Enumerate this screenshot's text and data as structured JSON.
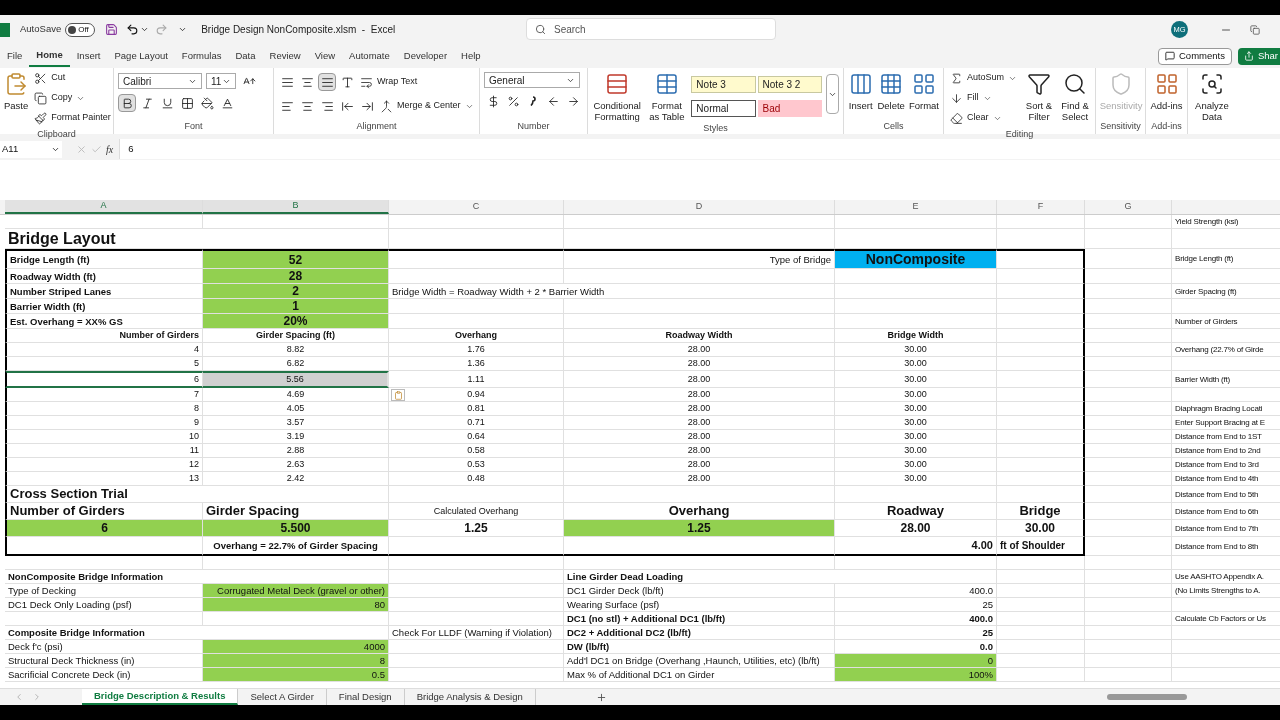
{
  "title_bar": {
    "autosave_label": "AutoSave",
    "autosave": {
      "on": false,
      "label": "Off"
    },
    "file_title": "Bridge Design NonComposite.xlsm  -  Excel",
    "search_placeholder": "Search",
    "user_initials": "MG"
  },
  "menu_tabs": [
    {
      "label": "File",
      "selected": false
    },
    {
      "label": "Home",
      "selected": true
    },
    {
      "label": "Insert",
      "selected": false
    },
    {
      "label": "Page Layout",
      "selected": false
    },
    {
      "label": "Formulas",
      "selected": false
    },
    {
      "label": "Data",
      "selected": false
    },
    {
      "label": "Review",
      "selected": false
    },
    {
      "label": "View",
      "selected": false
    },
    {
      "label": "Automate",
      "selected": false
    },
    {
      "label": "Developer",
      "selected": false
    },
    {
      "label": "Help",
      "selected": false
    }
  ],
  "comments_button": "Comments",
  "share_button": "Shar",
  "ribbon": {
    "clipboard": {
      "group": "Clipboard",
      "paste": "Paste",
      "cut": "Cut",
      "copy": "Copy",
      "format_painter": "Format Painter"
    },
    "font": {
      "group": "Font",
      "font_name": "Calibri",
      "font_size": "11",
      "bold": true
    },
    "alignment": {
      "group": "Alignment",
      "wrap_text": "Wrap Text",
      "merge_center": "Merge & Center",
      "bottom_align": true
    },
    "number": {
      "group": "Number",
      "format": "General"
    },
    "styles": {
      "group": "Styles",
      "conditional": "Conditional Formatting",
      "format_table": "Format as Table",
      "cell_styles": [
        {
          "label": "Note 3",
          "kind": "note"
        },
        {
          "label": "Note 3 2",
          "kind": "note"
        },
        {
          "label": "Normal",
          "kind": "normal"
        },
        {
          "label": "Bad",
          "kind": "bad"
        }
      ]
    },
    "cells": {
      "group": "Cells",
      "insert": "Insert",
      "delete": "Delete",
      "format": "Format"
    },
    "editing": {
      "group": "Editing",
      "autosum": "AutoSum",
      "fill": "Fill",
      "clear": "Clear",
      "sort": "Sort & Filter",
      "find": "Find & Select"
    },
    "sensitivity": {
      "group": "Sensitivity",
      "button": "Sensitivity",
      "disabled": true
    },
    "addins": {
      "group": "Add-ins",
      "button": "Add-ins"
    },
    "analyze": {
      "button": "Analyze Data"
    }
  },
  "formula_bar": {
    "name_box": "A11",
    "fx": "fx",
    "value": "6"
  },
  "sheet": {
    "column_headers": [
      {
        "label": "A",
        "selected": true
      },
      {
        "label": "B",
        "selected": true
      },
      {
        "label": "C",
        "selected": false
      },
      {
        "label": "D",
        "selected": false
      },
      {
        "label": "E",
        "selected": false
      },
      {
        "label": "F",
        "selected": false
      },
      {
        "label": "G",
        "selected": false
      }
    ],
    "rows": [
      {
        "boxed": false,
        "selected": false,
        "cells": {
          "h": {
            "text": "Yield Strength (ksi)",
            "kind": "text"
          }
        }
      },
      {
        "boxed": false,
        "selected": false,
        "cells": {
          "a": {
            "text": "Bridge Layout",
            "kind": "title"
          }
        }
      },
      {
        "boxed": true,
        "selected": false,
        "cells": {
          "a": {
            "text": "Bridge Length (ft)",
            "kind": "label"
          },
          "b": {
            "text": "52",
            "kind": "input-big"
          },
          "d": {
            "text": "Type of Bridge",
            "kind": "text-right"
          },
          "e": {
            "text": "NonComposite",
            "kind": "type-value"
          },
          "h": {
            "text": "Bridge Length (ft)",
            "kind": "text"
          }
        }
      },
      {
        "boxed": true,
        "selected": false,
        "cells": {
          "a": {
            "text": "Roadway Width (ft)",
            "kind": "label"
          },
          "b": {
            "text": "28",
            "kind": "input-big"
          }
        }
      },
      {
        "boxed": true,
        "selected": false,
        "cells": {
          "a": {
            "text": "Number Striped Lanes",
            "kind": "label"
          },
          "b": {
            "text": "2",
            "kind": "input-big"
          },
          "c": {
            "text": "Bridge Width = Roadway Width + 2 * Barrier Width",
            "kind": "text"
          },
          "h": {
            "text": "Girder Spacing (ft)",
            "kind": "text"
          }
        }
      },
      {
        "boxed": true,
        "selected": false,
        "cells": {
          "a": {
            "text": "Barrier Width (ft)",
            "kind": "label"
          },
          "b": {
            "text": "1",
            "kind": "input-big"
          }
        }
      },
      {
        "boxed": true,
        "selected": false,
        "cells": {
          "a": {
            "text": "Est. Overhang = XX% GS",
            "kind": "label"
          },
          "b": {
            "text": "20%",
            "kind": "input-big"
          },
          "h": {
            "text": "Number of Girders",
            "kind": "text"
          }
        }
      },
      {
        "boxed": true,
        "selected": false,
        "cells": {
          "a": {
            "text": "Number of Girders",
            "kind": "col-head-right"
          },
          "b": {
            "text": "Girder Spacing (ft)",
            "kind": "col-head"
          },
          "c": {
            "text": "Overhang",
            "kind": "col-head"
          },
          "d": {
            "text": "Roadway Width",
            "kind": "col-head"
          },
          "e": {
            "text": "Bridge Width",
            "kind": "col-head"
          }
        }
      },
      {
        "boxed": true,
        "selected": false,
        "cells": {
          "a": {
            "text": "4",
            "kind": "num-right"
          },
          "b": {
            "text": "8.82",
            "kind": "num"
          },
          "c": {
            "text": "1.76",
            "kind": "num"
          },
          "d": {
            "text": "28.00",
            "kind": "num"
          },
          "e": {
            "text": "30.00",
            "kind": "num"
          },
          "h": {
            "text": "Overhang (22.7% of Girde",
            "kind": "text"
          }
        }
      },
      {
        "boxed": true,
        "selected": false,
        "cells": {
          "a": {
            "text": "5",
            "kind": "num-right"
          },
          "b": {
            "text": "6.82",
            "kind": "num"
          },
          "c": {
            "text": "1.36",
            "kind": "num"
          },
          "d": {
            "text": "28.00",
            "kind": "num"
          },
          "e": {
            "text": "30.00",
            "kind": "num"
          }
        }
      },
      {
        "boxed": true,
        "selected": true,
        "cells": {
          "a": {
            "text": "6",
            "kind": "num-right"
          },
          "b": {
            "text": "5.56",
            "kind": "num"
          },
          "c": {
            "text": "1.11",
            "kind": "num"
          },
          "d": {
            "text": "28.00",
            "kind": "num"
          },
          "e": {
            "text": "30.00",
            "kind": "num"
          },
          "h": {
            "text": "Barrier Width (ft)",
            "kind": "text"
          }
        }
      },
      {
        "boxed": true,
        "selected": false,
        "paste_options": true,
        "cells": {
          "a": {
            "text": "7",
            "kind": "num-right"
          },
          "b": {
            "text": "4.69",
            "kind": "num"
          },
          "c": {
            "text": "0.94",
            "kind": "num"
          },
          "d": {
            "text": "28.00",
            "kind": "num"
          },
          "e": {
            "text": "30.00",
            "kind": "num"
          }
        }
      },
      {
        "boxed": true,
        "selected": false,
        "cells": {
          "a": {
            "text": "8",
            "kind": "num-right"
          },
          "b": {
            "text": "4.05",
            "kind": "num"
          },
          "c": {
            "text": "0.81",
            "kind": "num"
          },
          "d": {
            "text": "28.00",
            "kind": "num"
          },
          "e": {
            "text": "30.00",
            "kind": "num"
          },
          "h": {
            "text": "Diaphragm Bracing Locati",
            "kind": "text"
          }
        }
      },
      {
        "boxed": true,
        "selected": false,
        "cells": {
          "a": {
            "text": "9",
            "kind": "num-right"
          },
          "b": {
            "text": "3.57",
            "kind": "num"
          },
          "c": {
            "text": "0.71",
            "kind": "num"
          },
          "d": {
            "text": "28.00",
            "kind": "num"
          },
          "e": {
            "text": "30.00",
            "kind": "num"
          },
          "h": {
            "text": "Enter Support Bracing at E",
            "kind": "text"
          }
        }
      },
      {
        "boxed": true,
        "selected": false,
        "cells": {
          "a": {
            "text": "10",
            "kind": "num-right"
          },
          "b": {
            "text": "3.19",
            "kind": "num"
          },
          "c": {
            "text": "0.64",
            "kind": "num"
          },
          "d": {
            "text": "28.00",
            "kind": "num"
          },
          "e": {
            "text": "30.00",
            "kind": "num"
          },
          "h": {
            "text": "Distance from End to 1ST",
            "kind": "text"
          }
        }
      },
      {
        "boxed": true,
        "selected": false,
        "cells": {
          "a": {
            "text": "11",
            "kind": "num-right"
          },
          "b": {
            "text": "2.88",
            "kind": "num"
          },
          "c": {
            "text": "0.58",
            "kind": "num"
          },
          "d": {
            "text": "28.00",
            "kind": "num"
          },
          "e": {
            "text": "30.00",
            "kind": "num"
          },
          "h": {
            "text": "Distance from End to 2nd",
            "kind": "text"
          }
        }
      },
      {
        "boxed": true,
        "selected": false,
        "cells": {
          "a": {
            "text": "12",
            "kind": "num-right"
          },
          "b": {
            "text": "2.63",
            "kind": "num"
          },
          "c": {
            "text": "0.53",
            "kind": "num"
          },
          "d": {
            "text": "28.00",
            "kind": "num"
          },
          "e": {
            "text": "30.00",
            "kind": "num"
          },
          "h": {
            "text": "Distance from End to 3rd",
            "kind": "text"
          }
        }
      },
      {
        "boxed": true,
        "selected": false,
        "cells": {
          "a": {
            "text": "13",
            "kind": "num-right"
          },
          "b": {
            "text": "2.42",
            "kind": "num"
          },
          "c": {
            "text": "0.48",
            "kind": "num"
          },
          "d": {
            "text": "28.00",
            "kind": "num"
          },
          "e": {
            "text": "30.00",
            "kind": "num"
          },
          "h": {
            "text": "Distance from End to 4th",
            "kind": "text"
          }
        }
      },
      {
        "boxed": true,
        "selected": false,
        "cells": {
          "a": {
            "text": "Cross Section Trial",
            "kind": "heading-l"
          },
          "h": {
            "text": "Distance from End to 5th",
            "kind": "text"
          }
        }
      },
      {
        "boxed": true,
        "selected": false,
        "cells": {
          "a": {
            "text": "Number of Girders",
            "kind": "heading-l"
          },
          "b": {
            "text": "Girder Spacing",
            "kind": "heading-l"
          },
          "c": {
            "text": "Calculated Overhang",
            "kind": "text-center"
          },
          "d": {
            "text": "Overhang",
            "kind": "heading-c"
          },
          "e": {
            "text": "Roadway",
            "kind": "heading-c"
          },
          "f": {
            "text": "Bridge",
            "kind": "heading-c"
          },
          "h": {
            "text": "Distance from End to 6th",
            "kind": "text"
          }
        }
      },
      {
        "boxed": true,
        "selected": false,
        "cells": {
          "a": {
            "text": "6",
            "kind": "green-value"
          },
          "b": {
            "text": "5.500",
            "kind": "green-value"
          },
          "c": {
            "text": "1.25",
            "kind": "big-value"
          },
          "d": {
            "text": "1.25",
            "kind": "green-value"
          },
          "e": {
            "text": "28.00",
            "kind": "big-value"
          },
          "f": {
            "text": "30.00",
            "kind": "big-value"
          },
          "h": {
            "text": "Distance from End to 7th",
            "kind": "text"
          }
        }
      },
      {
        "boxed": true,
        "selected": false,
        "cells": {
          "b": {
            "text": "Overhang = 22.7% of Girder Spacing",
            "kind": "bold-center"
          },
          "e": {
            "text": "4.00",
            "kind": "bold-right"
          },
          "f": {
            "text": "ft of Shoulder",
            "kind": "bold-left"
          },
          "h": {
            "text": "Distance from End to 8th",
            "kind": "text"
          }
        }
      },
      {
        "boxed": false,
        "selected": false
      },
      {
        "boxed": false,
        "selected": false,
        "cells": {
          "a": {
            "text": "NonComposite Bridge Information",
            "kind": "section"
          },
          "d": {
            "text": "Line Girder Dead Loading",
            "kind": "section"
          },
          "h": {
            "text": "Use AASHTO Appendix A.",
            "kind": "text"
          }
        }
      },
      {
        "boxed": false,
        "selected": false,
        "cells": {
          "a": {
            "text": "Type of Decking",
            "kind": "text"
          },
          "b": {
            "text": "Corrugated Metal Deck (gravel or other)",
            "kind": "input"
          },
          "d": {
            "text": "DC1 Girder Deck (lb/ft)",
            "kind": "text"
          },
          "e": {
            "text": "400.0",
            "kind": "text-right"
          },
          "h": {
            "text": "(No Limits Strengths to A.",
            "kind": "text"
          }
        }
      },
      {
        "boxed": false,
        "selected": false,
        "cells": {
          "a": {
            "text": "DC1 Deck Only Loading (psf)",
            "kind": "text"
          },
          "b": {
            "text": "80",
            "kind": "input"
          },
          "d": {
            "text": "Wearing Surface (psf)",
            "kind": "text"
          },
          "e": {
            "text": "25",
            "kind": "text-right"
          }
        }
      },
      {
        "boxed": false,
        "selected": false,
        "cells": {
          "d": {
            "text": "DC1 (no stl) + Additional DC1 (lb/ft)",
            "kind": "section"
          },
          "e": {
            "text": "400.0",
            "kind": "bold-num"
          },
          "h": {
            "text": "Calculate Cb Factors or Us",
            "kind": "text"
          }
        }
      },
      {
        "boxed": false,
        "selected": false,
        "cells": {
          "a": {
            "text": "Composite Bridge Information",
            "kind": "section"
          },
          "c": {
            "text": "Check For LLDF (Warning if Violation)",
            "kind": "text"
          },
          "d": {
            "text": "DC2  + Additional DC2 (lb/ft)",
            "kind": "section"
          },
          "e": {
            "text": "25",
            "kind": "bold-num"
          }
        }
      },
      {
        "boxed": false,
        "selected": false,
        "cells": {
          "a": {
            "text": "Deck f'c (psi)",
            "kind": "text"
          },
          "b": {
            "text": "4000",
            "kind": "input"
          },
          "d": {
            "text": "DW (lb/ft)",
            "kind": "section"
          },
          "e": {
            "text": "0.0",
            "kind": "bold-num"
          }
        }
      },
      {
        "boxed": false,
        "selected": false,
        "cells": {
          "a": {
            "text": "Structural Deck Thickness (in)",
            "kind": "text"
          },
          "b": {
            "text": "8",
            "kind": "input"
          },
          "d": {
            "text": "Add'l DC1  on Bridge (Overhang ,Haunch, Utilities, etc) (lb/ft)",
            "kind": "text"
          },
          "e": {
            "text": "0",
            "kind": "input"
          }
        }
      },
      {
        "boxed": false,
        "selected": false,
        "cells": {
          "a": {
            "text": "Sacrificial Concrete Deck (in)",
            "kind": "text"
          },
          "b": {
            "text": "0.5",
            "kind": "input"
          },
          "d": {
            "text": "Max % of Additional DC1 on Girder",
            "kind": "text"
          },
          "e": {
            "text": "100%",
            "kind": "input"
          }
        }
      }
    ]
  },
  "sheet_tabs": [
    {
      "label": "Bridge Description & Results",
      "selected": true
    },
    {
      "label": "Select A Girder",
      "selected": false
    },
    {
      "label": "Final Design",
      "selected": false
    },
    {
      "label": "Bridge Analysis & Design",
      "selected": false
    }
  ]
}
